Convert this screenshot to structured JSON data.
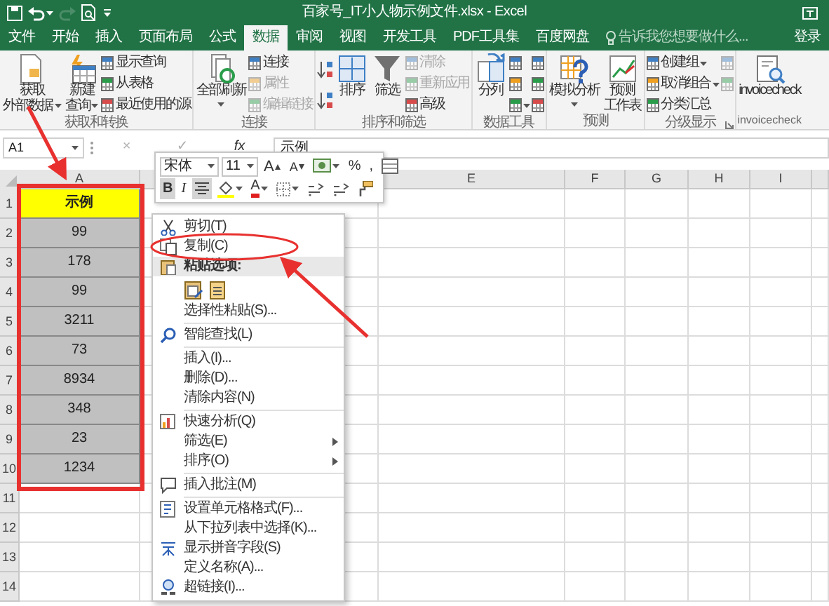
{
  "title_bar": {
    "title": "百家号_IT小人物示例文件.xlsx - Excel",
    "quick_access": [
      {
        "kind": "save",
        "dropdown": false,
        "disabled": false
      },
      {
        "kind": "undo",
        "dropdown": true,
        "disabled": false
      },
      {
        "kind": "redo",
        "dropdown": false,
        "disabled": true
      },
      {
        "kind": "preview",
        "dropdown": false,
        "disabled": false
      },
      {
        "kind": "customize",
        "dropdown": false,
        "disabled": false
      }
    ]
  },
  "tabs": [
    {
      "label": "文件",
      "selected": false
    },
    {
      "label": "开始",
      "selected": false
    },
    {
      "label": "插入",
      "selected": false
    },
    {
      "label": "页面布局",
      "selected": false
    },
    {
      "label": "公式",
      "selected": false
    },
    {
      "label": "数据",
      "selected": true
    },
    {
      "label": "审阅",
      "selected": false
    },
    {
      "label": "视图",
      "selected": false
    },
    {
      "label": "开发工具",
      "selected": false
    },
    {
      "label": "PDF工具集",
      "selected": false
    },
    {
      "label": "百度网盘",
      "selected": false
    }
  ],
  "tell_me": {
    "placeholder": "告诉我您想要做什么..."
  },
  "sign_in": "登录",
  "ribbon_groups": [
    {
      "label": "获取和转换",
      "launcher": false,
      "buttons": [
        {
          "kind": "large",
          "lines": [
            "获取",
            "外部数据"
          ],
          "dropdown": true,
          "disabled": false
        },
        {
          "kind": "large",
          "lines": [
            "新建",
            "查询"
          ],
          "dropdown": true,
          "disabled": false
        },
        {
          "kind": "small",
          "label": "显示查询",
          "dropdown": false,
          "disabled": false
        },
        {
          "kind": "small",
          "label": "从表格",
          "dropdown": false,
          "disabled": false
        },
        {
          "kind": "small",
          "label": "最近使用的源",
          "dropdown": false,
          "disabled": false
        }
      ]
    },
    {
      "label": "连接",
      "launcher": false,
      "buttons": [
        {
          "kind": "large",
          "lines": [
            "全部刷新"
          ],
          "dropdown": true,
          "disabled": false
        },
        {
          "kind": "small",
          "label": "连接",
          "dropdown": false,
          "disabled": false
        },
        {
          "kind": "small",
          "label": "属性",
          "dropdown": false,
          "disabled": true
        },
        {
          "kind": "small",
          "label": "编辑链接",
          "dropdown": false,
          "disabled": true
        }
      ]
    },
    {
      "label": "排序和筛选",
      "launcher": false,
      "buttons": [
        {
          "kind": "sort",
          "dropdown": false,
          "disabled": false
        },
        {
          "kind": "sort",
          "dropdown": false,
          "disabled": false
        },
        {
          "kind": "large",
          "lines": [
            "排序"
          ],
          "dropdown": false,
          "disabled": false
        },
        {
          "kind": "large",
          "lines": [
            "筛选"
          ],
          "dropdown": false,
          "disabled": false
        },
        {
          "kind": "small",
          "label": "清除",
          "dropdown": false,
          "disabled": true
        },
        {
          "kind": "small",
          "label": "重新应用",
          "dropdown": false,
          "disabled": true
        },
        {
          "kind": "small",
          "label": "高级",
          "dropdown": false,
          "disabled": false
        }
      ]
    },
    {
      "label": "数据工具",
      "launcher": false,
      "buttons": [
        {
          "kind": "large",
          "lines": [
            "分列"
          ],
          "dropdown": false,
          "disabled": false
        },
        {
          "kind": "icon",
          "dropdown": false,
          "disabled": false
        },
        {
          "kind": "icon",
          "dropdown": false,
          "disabled": false
        },
        {
          "kind": "icon",
          "dropdown": true,
          "disabled": false
        },
        {
          "kind": "icon",
          "dropdown": false,
          "disabled": false
        },
        {
          "kind": "icon",
          "dropdown": false,
          "disabled": false
        },
        {
          "kind": "icon",
          "dropdown": false,
          "disabled": false
        }
      ]
    },
    {
      "label": "预测",
      "launcher": false,
      "buttons": [
        {
          "kind": "large",
          "lines": [
            "模拟分析"
          ],
          "dropdown": true,
          "disabled": false
        },
        {
          "kind": "large",
          "lines": [
            "预测",
            "工作表"
          ],
          "dropdown": false,
          "disabled": false
        }
      ]
    },
    {
      "label": "分级显示",
      "launcher": true,
      "buttons": [
        {
          "kind": "small",
          "label": "创建组",
          "dropdown": true,
          "disabled": false
        },
        {
          "kind": "small",
          "label": "取消组合",
          "dropdown": true,
          "disabled": false
        },
        {
          "kind": "small",
          "label": "分类汇总",
          "dropdown": false,
          "disabled": false
        },
        {
          "kind": "icon",
          "dropdown": false,
          "disabled": true
        },
        {
          "kind": "icon",
          "dropdown": false,
          "disabled": true
        }
      ]
    },
    {
      "label": "invoicecheck",
      "launcher": false,
      "buttons": [
        {
          "kind": "large",
          "lines": [
            "invoicecheck"
          ],
          "dropdown": false,
          "disabled": false
        }
      ]
    }
  ],
  "formula_bar": {
    "name_box": "A1",
    "buttons": [
      {
        "text": "×",
        "disabled": true
      },
      {
        "text": "✓",
        "disabled": true
      },
      {
        "text": "fx",
        "disabled": false
      }
    ],
    "value": "示例"
  },
  "sheet": {
    "columns": [
      "A",
      "E",
      "F",
      "G",
      "H",
      "I"
    ],
    "rows": [
      "1",
      "2",
      "3",
      "4",
      "5",
      "6",
      "7",
      "8",
      "9",
      "10",
      "11",
      "12",
      "13",
      "14"
    ],
    "column_a": [
      {
        "kind": "header",
        "text": "示例"
      },
      {
        "kind": "value",
        "text": "99"
      },
      {
        "kind": "value",
        "text": "178"
      },
      {
        "kind": "value",
        "text": "99"
      },
      {
        "kind": "value",
        "text": "3211"
      },
      {
        "kind": "value",
        "text": "73"
      },
      {
        "kind": "value",
        "text": "8934"
      },
      {
        "kind": "value",
        "text": "348"
      },
      {
        "kind": "value",
        "text": "23"
      },
      {
        "kind": "value",
        "text": "1234"
      }
    ]
  },
  "mini_toolbar": {
    "font": "宋体",
    "size": "11",
    "row_1": [
      {
        "kind": "grow",
        "text": "A",
        "selected": false,
        "dropdown": false
      },
      {
        "kind": "shrink",
        "text": "A",
        "selected": false,
        "dropdown": false
      },
      {
        "kind": "currency",
        "selected": false,
        "dropdown": true
      },
      {
        "kind": "glyph",
        "text": "%",
        "selected": false,
        "dropdown": false
      },
      {
        "kind": "glyph",
        "text": ",",
        "selected": false,
        "dropdown": false
      },
      {
        "kind": "table",
        "selected": false,
        "dropdown": false
      }
    ],
    "row_2": [
      {
        "kind": "bold",
        "text": "B",
        "selected": true,
        "dropdown": false
      },
      {
        "kind": "italic",
        "text": "I",
        "selected": false,
        "dropdown": false
      },
      {
        "kind": "align",
        "selected": true,
        "dropdown": false
      },
      {
        "kind": "fill",
        "selected": false,
        "dropdown": true
      },
      {
        "kind": "font_color",
        "text": "A",
        "selected": false,
        "dropdown": true
      },
      {
        "kind": "border",
        "selected": false,
        "dropdown": true
      },
      {
        "kind": "decimal",
        "selected": false,
        "dropdown": false
      },
      {
        "kind": "decimal",
        "selected": false,
        "dropdown": false
      },
      {
        "kind": "painter",
        "selected": false,
        "dropdown": false
      }
    ]
  },
  "context_menu": [
    {
      "kind": "item",
      "text": "剪切(T)",
      "submenu": false
    },
    {
      "kind": "item",
      "text": "复制(C)",
      "submenu": false
    },
    {
      "kind": "header",
      "text": "粘贴选项:"
    },
    {
      "kind": "paste_icons"
    },
    {
      "kind": "item",
      "text": "选择性粘贴(S)...",
      "submenu": false
    },
    {
      "kind": "separator"
    },
    {
      "kind": "item",
      "text": "智能查找(L)",
      "submenu": false
    },
    {
      "kind": "separator"
    },
    {
      "kind": "item",
      "text": "插入(I)...",
      "submenu": false
    },
    {
      "kind": "item",
      "text": "删除(D)...",
      "submenu": false
    },
    {
      "kind": "item",
      "text": "清除内容(N)",
      "submenu": false
    },
    {
      "kind": "separator"
    },
    {
      "kind": "item",
      "text": "快速分析(Q)",
      "submenu": false
    },
    {
      "kind": "item",
      "text": "筛选(E)",
      "submenu": true
    },
    {
      "kind": "item",
      "text": "排序(O)",
      "submenu": true
    },
    {
      "kind": "separator"
    },
    {
      "kind": "item",
      "text": "插入批注(M)",
      "submenu": false
    },
    {
      "kind": "separator"
    },
    {
      "kind": "item",
      "text": "设置单元格格式(F)...",
      "submenu": false
    },
    {
      "kind": "item",
      "text": "从下拉列表中选择(K)...",
      "submenu": false
    },
    {
      "kind": "item",
      "text": "显示拼音字段(S)",
      "submenu": false
    },
    {
      "kind": "item",
      "text": "定义名称(A)...",
      "submenu": false
    },
    {
      "kind": "item",
      "text": "超链接(I)...",
      "submenu": false
    }
  ]
}
